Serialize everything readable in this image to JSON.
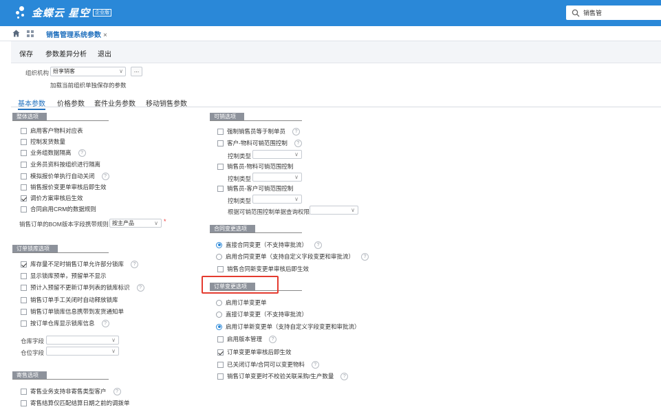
{
  "app": {
    "logo_text": "金蝶云 星空",
    "logo_badge": "企业版"
  },
  "search": {
    "value": "销售管"
  },
  "tabs": {
    "active_label": "销售管理系统参数",
    "close": "×"
  },
  "toolbar": {
    "save": "保存",
    "diff": "参数差异分析",
    "exit": "退出"
  },
  "org": {
    "label": "组织机构",
    "value": "纷享销客",
    "more": "...",
    "note": "加载当前组织单独保存的参数"
  },
  "subtabs": [
    "基本参数",
    "价格参数",
    "套件业务参数",
    "移动销售参数"
  ],
  "left": {
    "overall": {
      "title": "整体选项",
      "items": [
        {
          "label": "启用客户物料对应表",
          "checked": false,
          "help": false
        },
        {
          "label": "控制发货数量",
          "checked": false,
          "help": false
        },
        {
          "label": "业务组数据隔离",
          "checked": false,
          "help": true
        },
        {
          "label": "业务员资料按组织进行隔离",
          "checked": false,
          "help": false
        },
        {
          "label": "模拟报价单执行自动关闭",
          "checked": false,
          "help": true
        },
        {
          "label": "销售报价变更单审核后即生效",
          "checked": false,
          "help": false
        },
        {
          "label": "调价方案审核后生效",
          "checked": true,
          "help": false
        },
        {
          "label": "合同启用CRM的数据规则",
          "checked": false,
          "help": false
        }
      ],
      "bom_label": "销售订单的BOM版本字段携带规则",
      "bom_value": "按主产品",
      "required": "*"
    },
    "lock": {
      "title": "订单锁库选项",
      "items": [
        {
          "label": "库存量不足时销售订单允许部分锁库",
          "checked": true,
          "help": true
        },
        {
          "label": "显示锁库预单，预留单不显示",
          "checked": false,
          "help": false
        },
        {
          "label": "预计入预留不更新订单列表的锁库标识",
          "checked": false,
          "help": true
        },
        {
          "label": "销售订单手工关闭时自动释放锁库",
          "checked": false,
          "help": false
        },
        {
          "label": "销售订单锁库信息携带到发货通知单",
          "checked": false,
          "help": false
        },
        {
          "label": "按订单仓库显示锁库信息",
          "checked": false,
          "help": true
        }
      ],
      "warehouse_label": "仓库字段",
      "location_label": "仓位字段"
    },
    "consign": {
      "title": "寄售选项",
      "items": [
        {
          "label": "寄售业务支持非寄售类型客户",
          "checked": false,
          "help": true
        },
        {
          "label": "寄售结算仅匹配结算日期之前的调拨单",
          "checked": false,
          "help": false
        }
      ]
    }
  },
  "right": {
    "sellable": {
      "title": "可销选项",
      "items": [
        {
          "label": "强制销售员等于制单员",
          "checked": false,
          "help": true
        },
        {
          "label": "客户-物料可销范围控制",
          "checked": false,
          "help": true
        },
        {
          "label": "销售员-物料可销范围控制",
          "checked": false,
          "help": false
        },
        {
          "label": "销售员-客户可销范围控制",
          "checked": false,
          "help": false
        }
      ],
      "control_type": "控制类型",
      "query_label": "根据可销范围控制单据查询权限"
    },
    "contract_change": {
      "title": "合同变更选项",
      "options": [
        {
          "label": "直接合同变更（不支持审批流）",
          "selected": true,
          "help": true
        },
        {
          "label": "启用合同变更单（支持自定义字段变更和审批流）",
          "selected": false,
          "help": true
        }
      ],
      "check": {
        "label": "销售合同新变更单审核后即生效",
        "checked": false
      }
    },
    "order_change": {
      "title": "订单变更选项",
      "options": [
        {
          "label": "启用订单变更单",
          "selected": false,
          "help": false
        },
        {
          "label": "直接订单变更（不支持审批流）",
          "selected": false,
          "help": false
        },
        {
          "label": "启用订单新变更单（支持自定义字段变更和审批流）",
          "selected": true,
          "help": false
        }
      ],
      "checks": [
        {
          "label": "启用版本管理",
          "checked": false,
          "help": true
        },
        {
          "label": "订单变更单审核后即生效",
          "checked": true,
          "help": false
        },
        {
          "label": "已关闭订单/合同可以变更物料",
          "checked": false,
          "help": true
        },
        {
          "label": "销售订单变更时不校验关联采购/生产数量",
          "checked": false,
          "help": true
        }
      ]
    }
  },
  "colors": {
    "brand": "#2a88d8",
    "highlight": "#e43a2e"
  }
}
